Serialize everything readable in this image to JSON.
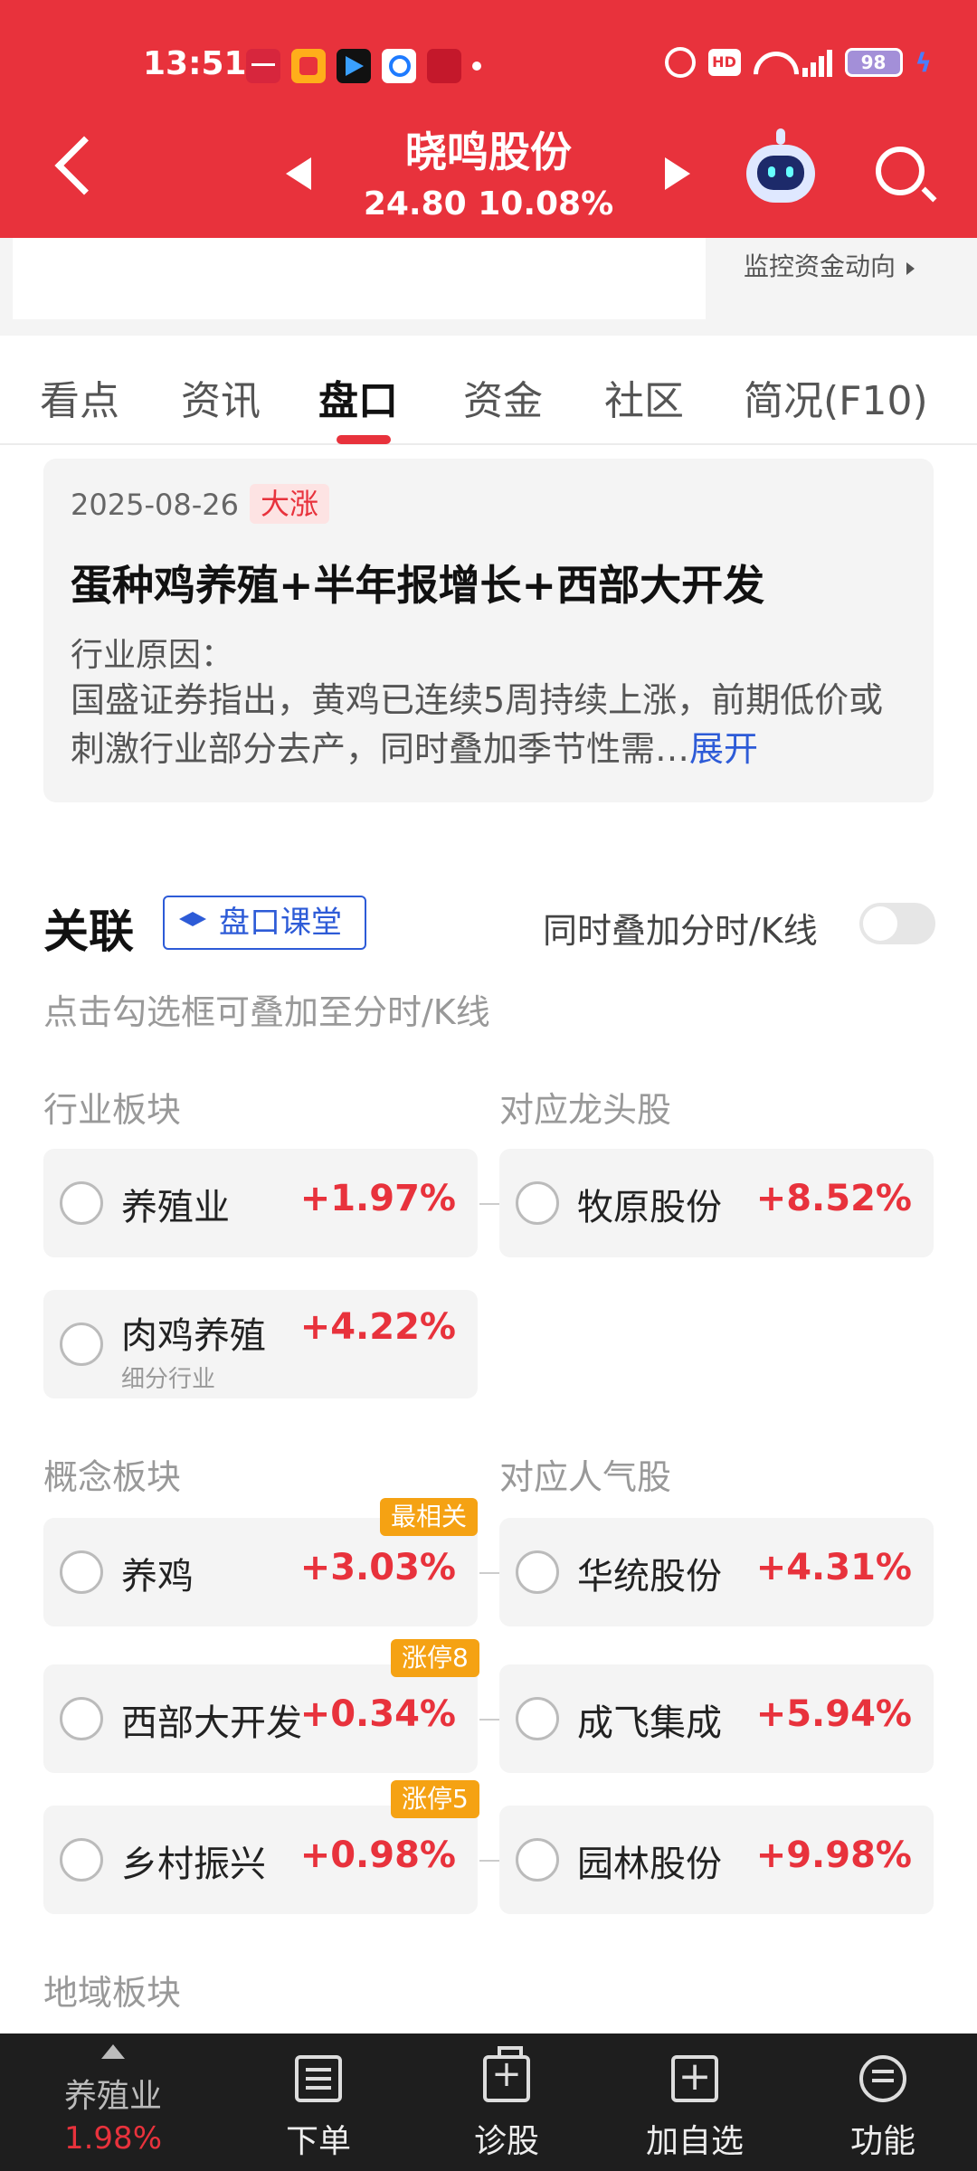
{
  "status_bar": {
    "time": "13:51",
    "hd_label": "HD",
    "battery": "98"
  },
  "header": {
    "stock_name": "晓鸣股份",
    "quote": "24.80 10.08%"
  },
  "monitor": {
    "link_label": "监控资金动向"
  },
  "tabs": [
    {
      "label": "看点"
    },
    {
      "label": "资讯"
    },
    {
      "label": "盘口"
    },
    {
      "label": "资金"
    },
    {
      "label": "社区"
    },
    {
      "label": "简况(F10)"
    }
  ],
  "news": {
    "date": "2025-08-26",
    "badge": "大涨",
    "title": "蛋种鸡养殖+半年报增长+西部大开发",
    "sub": "行业原因：",
    "body": "国盛证券指出，黄鸡已连续5周持续上涨，前期低价或刺激行业部分去产，同时叠加季节性需…",
    "expand": "展开"
  },
  "related": {
    "title": "关联",
    "class_button": "盘口课堂",
    "overlay_label": "同时叠加分时/K线",
    "hint": "点击勾选框可叠加至分时/K线"
  },
  "industry": {
    "label": "行业板块",
    "leader_label": "对应龙头股",
    "items": [
      {
        "name": "养殖业",
        "pct": "+1.97%"
      },
      {
        "name": "肉鸡养殖",
        "pct": "+4.22%",
        "sub": "细分行业"
      }
    ],
    "leaders": [
      {
        "name": "牧原股份",
        "pct": "+8.52%"
      }
    ]
  },
  "concept": {
    "label": "概念板块",
    "popular_label": "对应人气股",
    "items": [
      {
        "name": "养鸡",
        "pct": "+3.03%",
        "tag": "最相关"
      },
      {
        "name": "西部大开发",
        "pct": "+0.34%",
        "tag": "涨停8"
      },
      {
        "name": "乡村振兴",
        "pct": "+0.98%",
        "tag": "涨停5"
      }
    ],
    "popular": [
      {
        "name": "华统股份",
        "pct": "+4.31%"
      },
      {
        "name": "成飞集成",
        "pct": "+5.94%"
      },
      {
        "name": "园林股份",
        "pct": "+9.98%"
      }
    ]
  },
  "region": {
    "label": "地域板块"
  },
  "bottom_bar": {
    "sector_name": "养殖业",
    "sector_pct": "1.98%",
    "items": [
      {
        "label": "下单",
        "icon": "order-icon"
      },
      {
        "label": "诊股",
        "icon": "diagnose-icon"
      },
      {
        "label": "加自选",
        "icon": "add-watchlist-icon"
      },
      {
        "label": "功能",
        "icon": "function-icon"
      }
    ]
  },
  "colors": {
    "brand_red": "#e8323c",
    "up_red": "#e8323c",
    "link_blue": "#2d5bd7",
    "tag_orange": "#f5a213"
  }
}
